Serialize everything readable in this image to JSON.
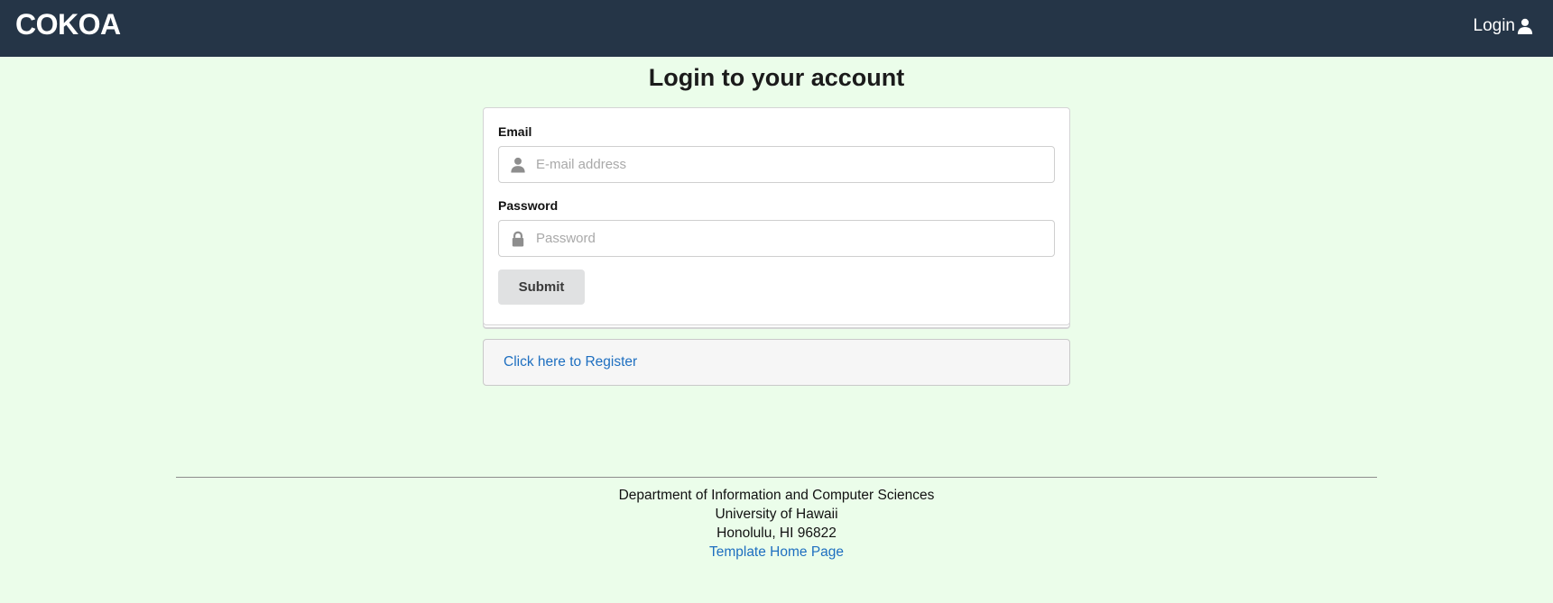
{
  "navbar": {
    "brand": "COKOA",
    "login_label": "Login",
    "login_icon": "user-icon",
    "background_color": "#253547"
  },
  "page": {
    "title": "Login to your account",
    "background_color": "#ebfdea"
  },
  "form": {
    "email": {
      "label": "Email",
      "placeholder": "E-mail address",
      "value": "",
      "icon": "user-icon"
    },
    "password": {
      "label": "Password",
      "placeholder": "Password",
      "value": "",
      "icon": "lock-icon"
    },
    "submit_label": "Submit"
  },
  "register": {
    "link_text": "Click here to Register"
  },
  "footer": {
    "line1": "Department of Information and Computer Sciences",
    "line2": "University of Hawaii",
    "line3": "Honolulu, HI 96822",
    "link_text": "Template Home Page"
  },
  "colors": {
    "link": "#1e6fc0",
    "button": "#e0e1e2"
  }
}
